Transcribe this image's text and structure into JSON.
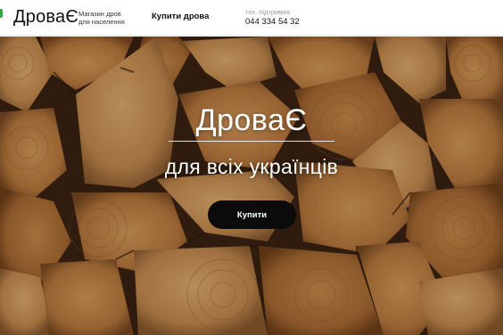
{
  "header": {
    "logo": "ДроваЄ",
    "tagline": [
      "Магазин дров",
      "для населення"
    ],
    "nav_link": "Купити дрова",
    "support_label": "тех. підтримка",
    "support_phone": "044 334 54 32"
  },
  "hero": {
    "title": "ДроваЄ",
    "subtitle": "для всіх українців",
    "button": "Купити",
    "background": "stacked-firewood-photo"
  },
  "colors": {
    "accent": "#3aa24a",
    "button_bg": "#0b0b0b",
    "wood": "#b8834a"
  }
}
